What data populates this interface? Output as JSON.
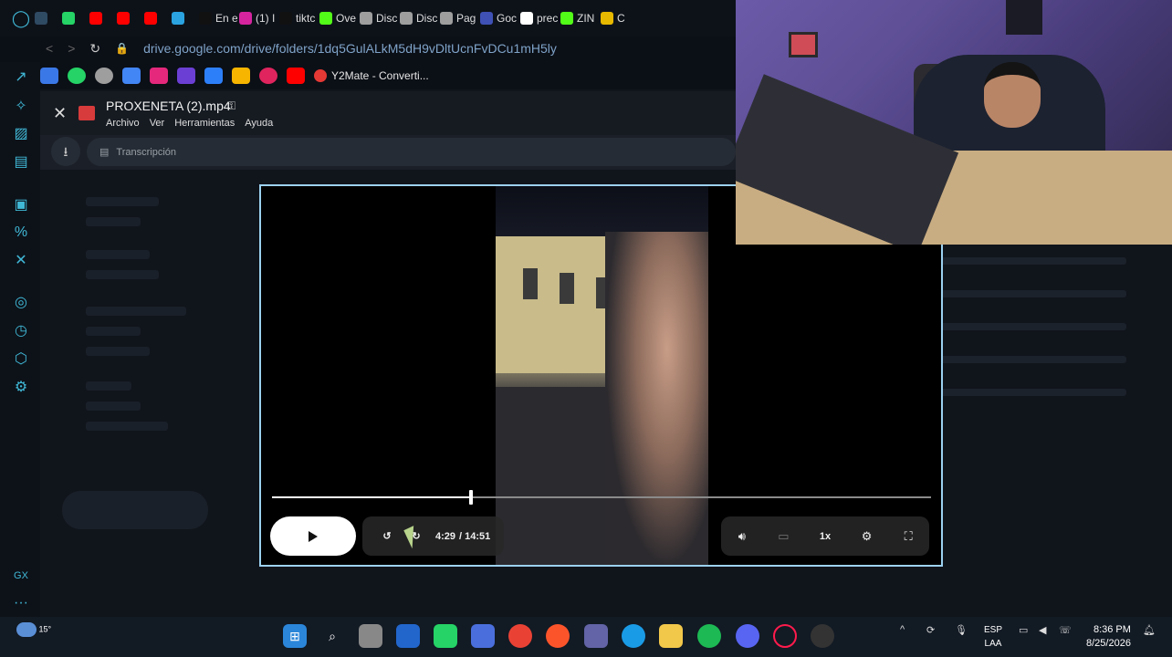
{
  "browser": {
    "tabs": [
      {
        "label": "",
        "color": "#2f4a63"
      },
      {
        "label": "",
        "color": "#25d366"
      },
      {
        "label": "",
        "color": "#ff0000"
      },
      {
        "label": "",
        "color": "#ff0000"
      },
      {
        "label": "",
        "color": "#ff0000"
      },
      {
        "label": "",
        "color": "#2aa3e0"
      },
      {
        "label": "En e",
        "color": "#111111"
      },
      {
        "label": "(1) I",
        "color": "#d6249f"
      },
      {
        "label": "tiktc",
        "color": "#111111"
      },
      {
        "label": "Ove",
        "color": "#53fc18"
      },
      {
        "label": "Disc",
        "color": "#9e9e9e"
      },
      {
        "label": "Disc",
        "color": "#9e9e9e"
      },
      {
        "label": "Pag",
        "color": "#9e9e9e"
      },
      {
        "label": "Goc",
        "color": "#3f51b5"
      },
      {
        "label": "prec",
        "color": "#ffffff"
      },
      {
        "label": "ZIN",
        "color": "#53fc18"
      },
      {
        "label": "C",
        "color": "#e6b800"
      }
    ],
    "url": "drive.google.com/drive/folders/1dq5GulALkM5dH9vDltUcnFvDCu1mH5ly",
    "bookmark_label": "Y2Mate - Converti..."
  },
  "viewer": {
    "file_title": "PROXENETA (2).mp4",
    "menu": [
      "Archivo",
      "Ver",
      "Herramientas",
      "Ayuda"
    ],
    "transcription_placeholder": "Transcripción"
  },
  "player": {
    "current_time": "4:29",
    "duration": "/ 14:51",
    "progress_fraction": 0.302,
    "speed": "1x",
    "state": "paused"
  },
  "taskbar": {
    "weather": "15°",
    "language_top": "ESP",
    "language_bottom": "LAA",
    "time": "8:36 PM",
    "date": "8/25/2026"
  }
}
